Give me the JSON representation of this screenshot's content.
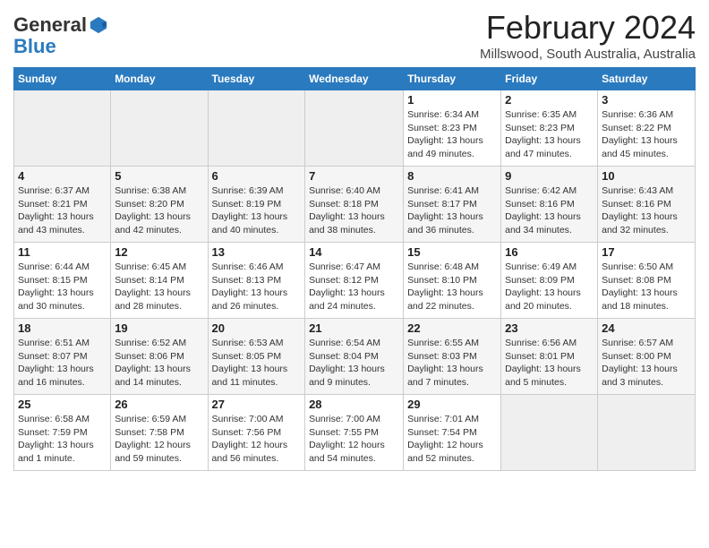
{
  "header": {
    "logo_general": "General",
    "logo_blue": "Blue",
    "month_title": "February 2024",
    "location": "Millswood, South Australia, Australia"
  },
  "weekdays": [
    "Sunday",
    "Monday",
    "Tuesday",
    "Wednesday",
    "Thursday",
    "Friday",
    "Saturday"
  ],
  "weeks": [
    [
      {
        "day": "",
        "sunrise": "",
        "sunset": "",
        "daylight": ""
      },
      {
        "day": "",
        "sunrise": "",
        "sunset": "",
        "daylight": ""
      },
      {
        "day": "",
        "sunrise": "",
        "sunset": "",
        "daylight": ""
      },
      {
        "day": "",
        "sunrise": "",
        "sunset": "",
        "daylight": ""
      },
      {
        "day": "1",
        "sunrise": "Sunrise: 6:34 AM",
        "sunset": "Sunset: 8:23 PM",
        "daylight": "Daylight: 13 hours and 49 minutes."
      },
      {
        "day": "2",
        "sunrise": "Sunrise: 6:35 AM",
        "sunset": "Sunset: 8:23 PM",
        "daylight": "Daylight: 13 hours and 47 minutes."
      },
      {
        "day": "3",
        "sunrise": "Sunrise: 6:36 AM",
        "sunset": "Sunset: 8:22 PM",
        "daylight": "Daylight: 13 hours and 45 minutes."
      }
    ],
    [
      {
        "day": "4",
        "sunrise": "Sunrise: 6:37 AM",
        "sunset": "Sunset: 8:21 PM",
        "daylight": "Daylight: 13 hours and 43 minutes."
      },
      {
        "day": "5",
        "sunrise": "Sunrise: 6:38 AM",
        "sunset": "Sunset: 8:20 PM",
        "daylight": "Daylight: 13 hours and 42 minutes."
      },
      {
        "day": "6",
        "sunrise": "Sunrise: 6:39 AM",
        "sunset": "Sunset: 8:19 PM",
        "daylight": "Daylight: 13 hours and 40 minutes."
      },
      {
        "day": "7",
        "sunrise": "Sunrise: 6:40 AM",
        "sunset": "Sunset: 8:18 PM",
        "daylight": "Daylight: 13 hours and 38 minutes."
      },
      {
        "day": "8",
        "sunrise": "Sunrise: 6:41 AM",
        "sunset": "Sunset: 8:17 PM",
        "daylight": "Daylight: 13 hours and 36 minutes."
      },
      {
        "day": "9",
        "sunrise": "Sunrise: 6:42 AM",
        "sunset": "Sunset: 8:16 PM",
        "daylight": "Daylight: 13 hours and 34 minutes."
      },
      {
        "day": "10",
        "sunrise": "Sunrise: 6:43 AM",
        "sunset": "Sunset: 8:16 PM",
        "daylight": "Daylight: 13 hours and 32 minutes."
      }
    ],
    [
      {
        "day": "11",
        "sunrise": "Sunrise: 6:44 AM",
        "sunset": "Sunset: 8:15 PM",
        "daylight": "Daylight: 13 hours and 30 minutes."
      },
      {
        "day": "12",
        "sunrise": "Sunrise: 6:45 AM",
        "sunset": "Sunset: 8:14 PM",
        "daylight": "Daylight: 13 hours and 28 minutes."
      },
      {
        "day": "13",
        "sunrise": "Sunrise: 6:46 AM",
        "sunset": "Sunset: 8:13 PM",
        "daylight": "Daylight: 13 hours and 26 minutes."
      },
      {
        "day": "14",
        "sunrise": "Sunrise: 6:47 AM",
        "sunset": "Sunset: 8:12 PM",
        "daylight": "Daylight: 13 hours and 24 minutes."
      },
      {
        "day": "15",
        "sunrise": "Sunrise: 6:48 AM",
        "sunset": "Sunset: 8:10 PM",
        "daylight": "Daylight: 13 hours and 22 minutes."
      },
      {
        "day": "16",
        "sunrise": "Sunrise: 6:49 AM",
        "sunset": "Sunset: 8:09 PM",
        "daylight": "Daylight: 13 hours and 20 minutes."
      },
      {
        "day": "17",
        "sunrise": "Sunrise: 6:50 AM",
        "sunset": "Sunset: 8:08 PM",
        "daylight": "Daylight: 13 hours and 18 minutes."
      }
    ],
    [
      {
        "day": "18",
        "sunrise": "Sunrise: 6:51 AM",
        "sunset": "Sunset: 8:07 PM",
        "daylight": "Daylight: 13 hours and 16 minutes."
      },
      {
        "day": "19",
        "sunrise": "Sunrise: 6:52 AM",
        "sunset": "Sunset: 8:06 PM",
        "daylight": "Daylight: 13 hours and 14 minutes."
      },
      {
        "day": "20",
        "sunrise": "Sunrise: 6:53 AM",
        "sunset": "Sunset: 8:05 PM",
        "daylight": "Daylight: 13 hours and 11 minutes."
      },
      {
        "day": "21",
        "sunrise": "Sunrise: 6:54 AM",
        "sunset": "Sunset: 8:04 PM",
        "daylight": "Daylight: 13 hours and 9 minutes."
      },
      {
        "day": "22",
        "sunrise": "Sunrise: 6:55 AM",
        "sunset": "Sunset: 8:03 PM",
        "daylight": "Daylight: 13 hours and 7 minutes."
      },
      {
        "day": "23",
        "sunrise": "Sunrise: 6:56 AM",
        "sunset": "Sunset: 8:01 PM",
        "daylight": "Daylight: 13 hours and 5 minutes."
      },
      {
        "day": "24",
        "sunrise": "Sunrise: 6:57 AM",
        "sunset": "Sunset: 8:00 PM",
        "daylight": "Daylight: 13 hours and 3 minutes."
      }
    ],
    [
      {
        "day": "25",
        "sunrise": "Sunrise: 6:58 AM",
        "sunset": "Sunset: 7:59 PM",
        "daylight": "Daylight: 13 hours and 1 minute."
      },
      {
        "day": "26",
        "sunrise": "Sunrise: 6:59 AM",
        "sunset": "Sunset: 7:58 PM",
        "daylight": "Daylight: 12 hours and 59 minutes."
      },
      {
        "day": "27",
        "sunrise": "Sunrise: 7:00 AM",
        "sunset": "Sunset: 7:56 PM",
        "daylight": "Daylight: 12 hours and 56 minutes."
      },
      {
        "day": "28",
        "sunrise": "Sunrise: 7:00 AM",
        "sunset": "Sunset: 7:55 PM",
        "daylight": "Daylight: 12 hours and 54 minutes."
      },
      {
        "day": "29",
        "sunrise": "Sunrise: 7:01 AM",
        "sunset": "Sunset: 7:54 PM",
        "daylight": "Daylight: 12 hours and 52 minutes."
      },
      {
        "day": "",
        "sunrise": "",
        "sunset": "",
        "daylight": ""
      },
      {
        "day": "",
        "sunrise": "",
        "sunset": "",
        "daylight": ""
      }
    ]
  ]
}
